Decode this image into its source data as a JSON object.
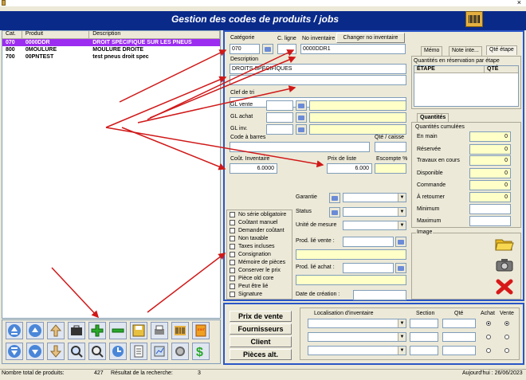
{
  "window": {
    "title": "Gestion des codes de produits / jobs",
    "close": "×"
  },
  "list": {
    "headers": [
      "Cat.",
      "Produit",
      "Description"
    ],
    "rows": [
      {
        "cat": "070",
        "code": "0000DDR",
        "desc": "DROIT SPÉCIFIQUE SUR LES PNEUS",
        "selected": true
      },
      {
        "cat": "800",
        "code": "0MOULURE",
        "desc": "MOULURE DROITE",
        "selected": false
      },
      {
        "cat": "700",
        "code": "00PNTEST",
        "desc": "test pneus droit spec",
        "selected": false
      }
    ]
  },
  "form": {
    "categorie_label": "Catégorie",
    "categorie_value": "070",
    "cligne_label": "C. ligne",
    "noinv_label": "No inventaire",
    "noinv_value": "0000DDR1",
    "change_btn": "Changer no inventaire",
    "description_label": "Description",
    "description_value": "DROITS SPÉCIFIQUES",
    "clef_label": "Clef de tri",
    "gl_vente_label": "GL vente",
    "gl_achat_label": "GL achat",
    "gl_inv_label": "GL inv.",
    "codebarres_label": "Code à barres",
    "qte_caisse_label": "Qté / caisse",
    "cout_label": "Coût. Inventaire",
    "cout_value": "6.0000",
    "prix_label": "Prix de liste",
    "prix_value": "6.000",
    "escompte_label": "Escompte %",
    "garantie_label": "Garantie",
    "status_label": "Status",
    "unite_label": "Unité de mesure",
    "prod_vente_label": "Prod. lié vente :",
    "prod_achat_label": "Prod. lié achat :",
    "date_label": "Date de création :"
  },
  "checkboxes": [
    "No série obligatoire",
    "Coûtant manuel",
    "Demander coûtant",
    "Non taxable",
    "Taxes incluses",
    "Consignation",
    "Mémoire de pièces",
    "Conserver le prix",
    "Pièce old core",
    "Peut être lié",
    "Signature"
  ],
  "tabs_top": [
    "Mémo",
    "Note inte...",
    "Qté étape"
  ],
  "etape": {
    "group_label": "Quantités en réservation par étape",
    "col1": "ÉTAPE",
    "col2": "QTÉ"
  },
  "quantites": {
    "tab": "Quantités",
    "group_label": "Quantités cumulées",
    "rows": [
      {
        "label": "En main",
        "value": "0"
      },
      {
        "label": "Réservée",
        "value": "0"
      },
      {
        "label": "Travaux en cours",
        "value": "0"
      },
      {
        "label": "Disponible",
        "value": "0"
      },
      {
        "label": "Commande",
        "value": "0"
      },
      {
        "label": "À retourner",
        "value": "0"
      },
      {
        "label": "Minimum",
        "value": ""
      },
      {
        "label": "Maximum",
        "value": ""
      }
    ]
  },
  "image_label": "Image",
  "bottom_buttons": [
    "Prix de vente",
    "Fournisseurs",
    "Client",
    "Pièces alt."
  ],
  "locations": {
    "col_loc": "Localisation d'inventaire",
    "col_section": "Section",
    "col_qte": "Qté",
    "col_achat": "Achat",
    "col_vente": "Vente"
  },
  "status": {
    "total_label": "Nombre total de produits:",
    "total_value": "427",
    "result_label": "Résultat de la recherche:",
    "result_value": "3",
    "today": "Aujourd'hui : 26/06/2023"
  }
}
